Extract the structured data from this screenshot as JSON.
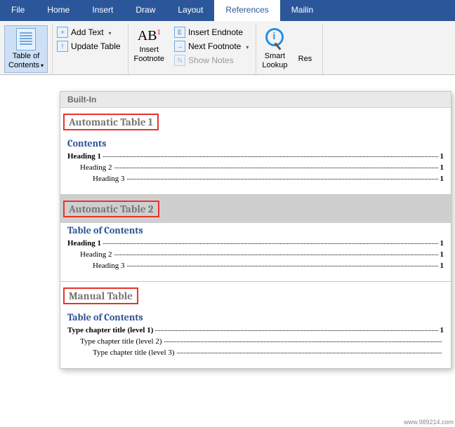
{
  "tabs": [
    "File",
    "Home",
    "Insert",
    "Draw",
    "Layout",
    "References",
    "Mailin"
  ],
  "active_tab": 5,
  "ribbon": {
    "toc": {
      "label_top": "Table of",
      "label_bottom": "Contents"
    },
    "add_text": "Add Text",
    "update_table": "Update Table",
    "insert_footnote_top": "Insert",
    "insert_footnote_bottom": "Footnote",
    "insert_endnote": "Insert Endnote",
    "next_footnote": "Next Footnote",
    "show_notes": "Show Notes",
    "smart_lookup_top": "Smart",
    "smart_lookup_bottom": "Lookup",
    "research": "Res"
  },
  "gallery": {
    "header": "Built-In",
    "style1": {
      "title": "Automatic Table 1",
      "heading": "Contents",
      "rows": [
        {
          "text": "Heading 1",
          "page": "1",
          "indent": 0
        },
        {
          "text": "Heading 2",
          "page": "1",
          "indent": 1
        },
        {
          "text": "Heading 3",
          "page": "1",
          "indent": 2
        }
      ]
    },
    "style2": {
      "title": "Automatic Table 2",
      "heading": "Table of Contents",
      "rows": [
        {
          "text": "Heading 1",
          "page": "1",
          "indent": 0
        },
        {
          "text": "Heading 2",
          "page": "1",
          "indent": 1
        },
        {
          "text": "Heading 3",
          "page": "1",
          "indent": 2
        }
      ]
    },
    "style3": {
      "title": "Manual Table",
      "heading": "Table of Contents",
      "rows": [
        {
          "text": "Type chapter title (level 1)",
          "page": "1",
          "indent": 0
        },
        {
          "text": "Type chapter title (level 2)",
          "page": "",
          "indent": 1
        },
        {
          "text": "Type chapter title (level 3)",
          "page": "",
          "indent": 2
        }
      ]
    }
  },
  "watermark": "www.989214.com"
}
